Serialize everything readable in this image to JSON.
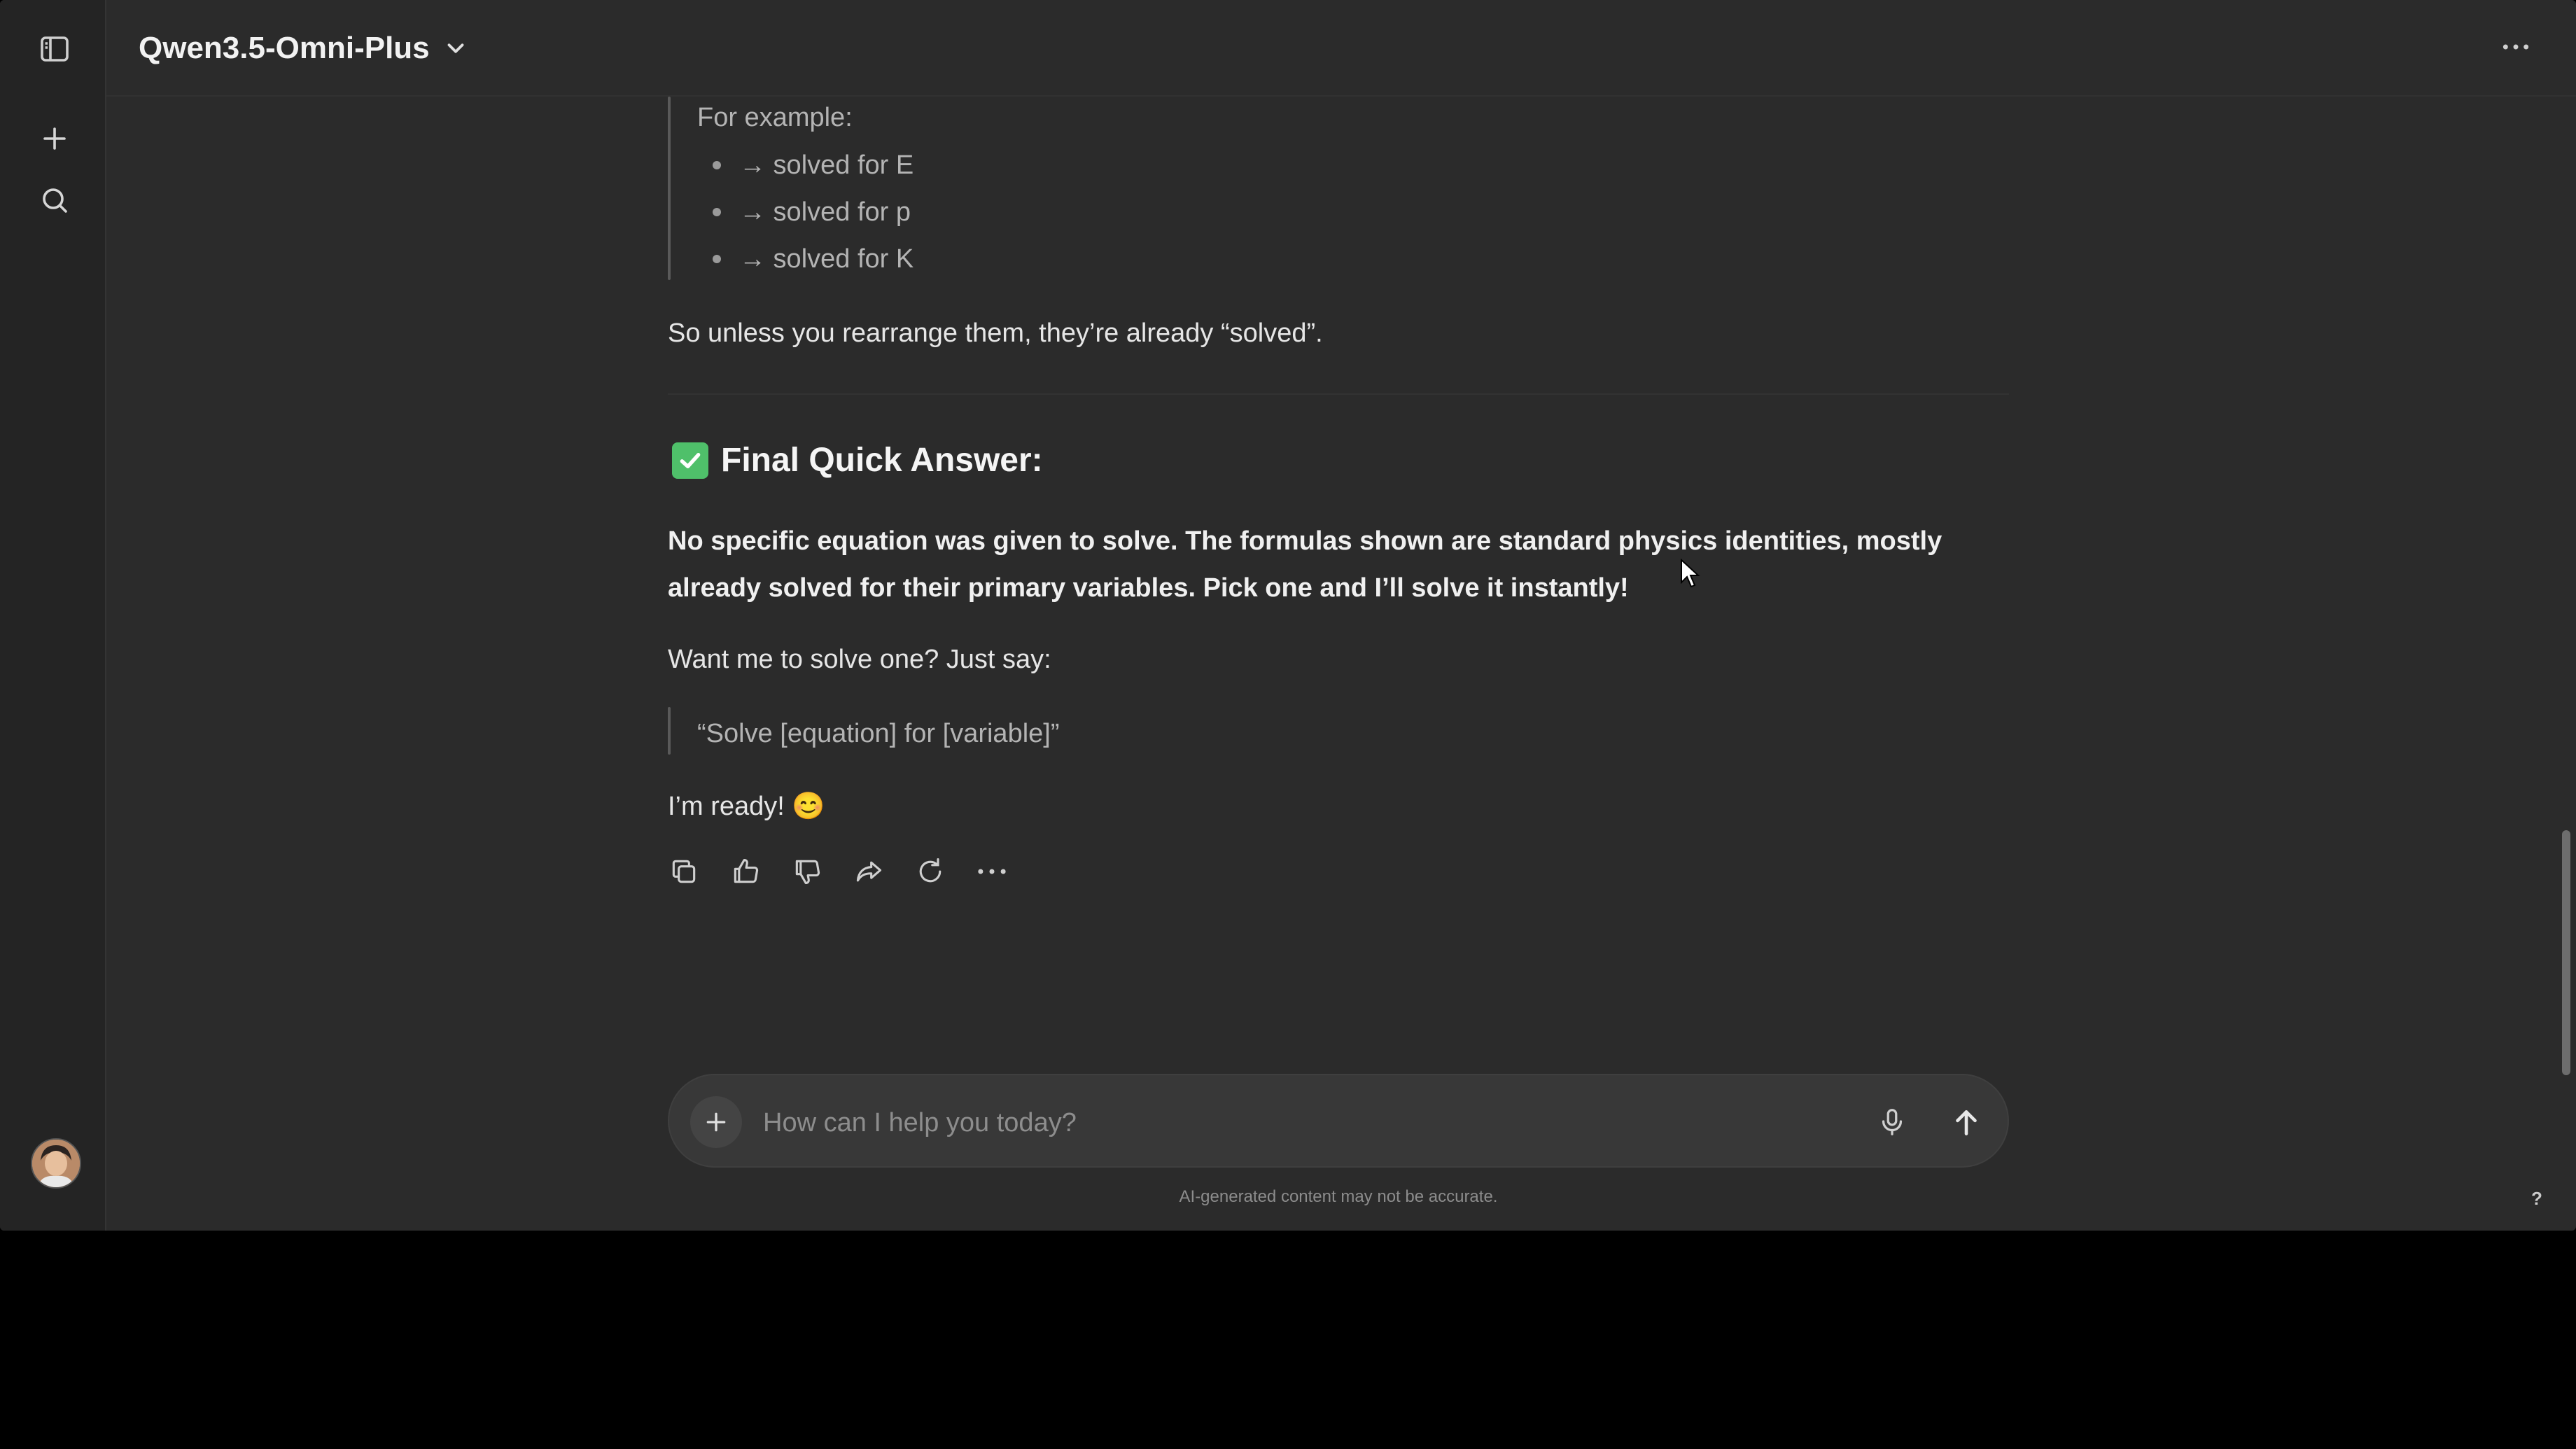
{
  "header": {
    "model_name": "Qwen3.5-Omni-Plus"
  },
  "message": {
    "example_label": "For example:",
    "example_items": [
      "→ solved for E",
      "→ solved for p",
      "→ solved for K"
    ],
    "note": "So unless you rearrange them, they’re already “solved”.",
    "heading": "Final Quick Answer:",
    "answer": "No specific equation was given to solve. The formulas shown are standard physics identities, mostly already solved for their primary variables. Pick one and I’ll solve it instantly!",
    "prompt_line": "Want me to solve one? Just say:",
    "quote": "“Solve [equation] for [variable]”",
    "closing": "I’m ready! 😊"
  },
  "composer": {
    "placeholder": "How can I help you today?"
  },
  "footer": {
    "disclaimer": "AI-generated content may not be accurate.",
    "help": "?"
  },
  "colors": {
    "background": "#2b2b2b",
    "sidebar": "#242424",
    "check": "#4fc06a"
  }
}
